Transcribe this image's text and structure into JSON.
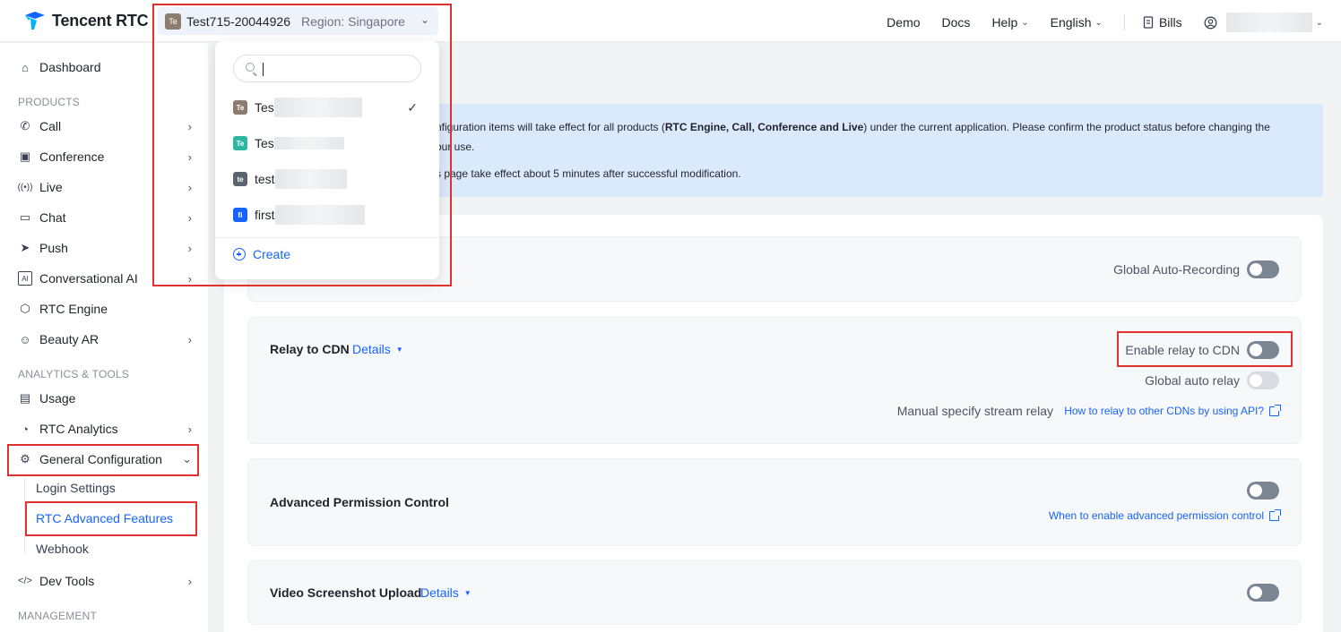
{
  "brand": {
    "name": "Tencent RTC"
  },
  "app_switcher": {
    "badge": "Te",
    "app_name": "Test715-20044926",
    "region": "Region: Singapore"
  },
  "topnav": {
    "demo": "Demo",
    "docs": "Docs",
    "help": "Help",
    "language": "English",
    "bills": "Bills"
  },
  "sidebar": {
    "dashboard": "Dashboard",
    "section_products": "PRODUCTS",
    "call": "Call",
    "conference": "Conference",
    "live": "Live",
    "chat": "Chat",
    "push": "Push",
    "conversational_ai": "Conversational AI",
    "rtc_engine": "RTC Engine",
    "beauty_ar": "Beauty AR",
    "section_analytics": "ANALYTICS & TOOLS",
    "usage": "Usage",
    "rtc_analytics": "RTC Analytics",
    "general_configuration": "General Configuration",
    "login_settings": "Login Settings",
    "rtc_advanced_features": "RTC Advanced Features",
    "webhook": "Webhook",
    "dev_tools": "Dev Tools",
    "section_management": "MANAGEMENT"
  },
  "notice": {
    "line1a": "nfiguration items will take effect for all products (",
    "line1b": "RTC Engine, Call, Conference and Live",
    "line1c": ") under the current application. Please confirm the product status before changing the",
    "line2": "our use.",
    "line3": "s page take effect about 5 minutes after successful modification."
  },
  "recording": {
    "label": "Global Auto-Recording",
    "enabled": false
  },
  "relay": {
    "title": "Relay to CDN",
    "details": "Details",
    "enable_label": "Enable relay to CDN",
    "enable_on": false,
    "global_label": "Global auto relay",
    "global_on": false,
    "manual_label": "Manual specify stream relay",
    "manual_link": "How to relay to other CDNs by using API?"
  },
  "permission": {
    "title": "Advanced Permission Control",
    "enabled": false,
    "link": "When to enable advanced permission control"
  },
  "screenshot": {
    "title": "Video Screenshot Upload",
    "details": "Details",
    "enabled": false
  },
  "dropdown": {
    "items": [
      {
        "badge": "Te",
        "label": "Tes",
        "color": "#8c7b6e",
        "selected": true
      },
      {
        "badge": "Te",
        "label": "Tes",
        "color": "#2fb5a3",
        "selected": false
      },
      {
        "badge": "te",
        "label": "test",
        "color": "#5b6270",
        "selected": false
      },
      {
        "badge": "fi",
        "label": "first",
        "color": "#1664ff",
        "selected": false
      }
    ],
    "create": "Create"
  }
}
